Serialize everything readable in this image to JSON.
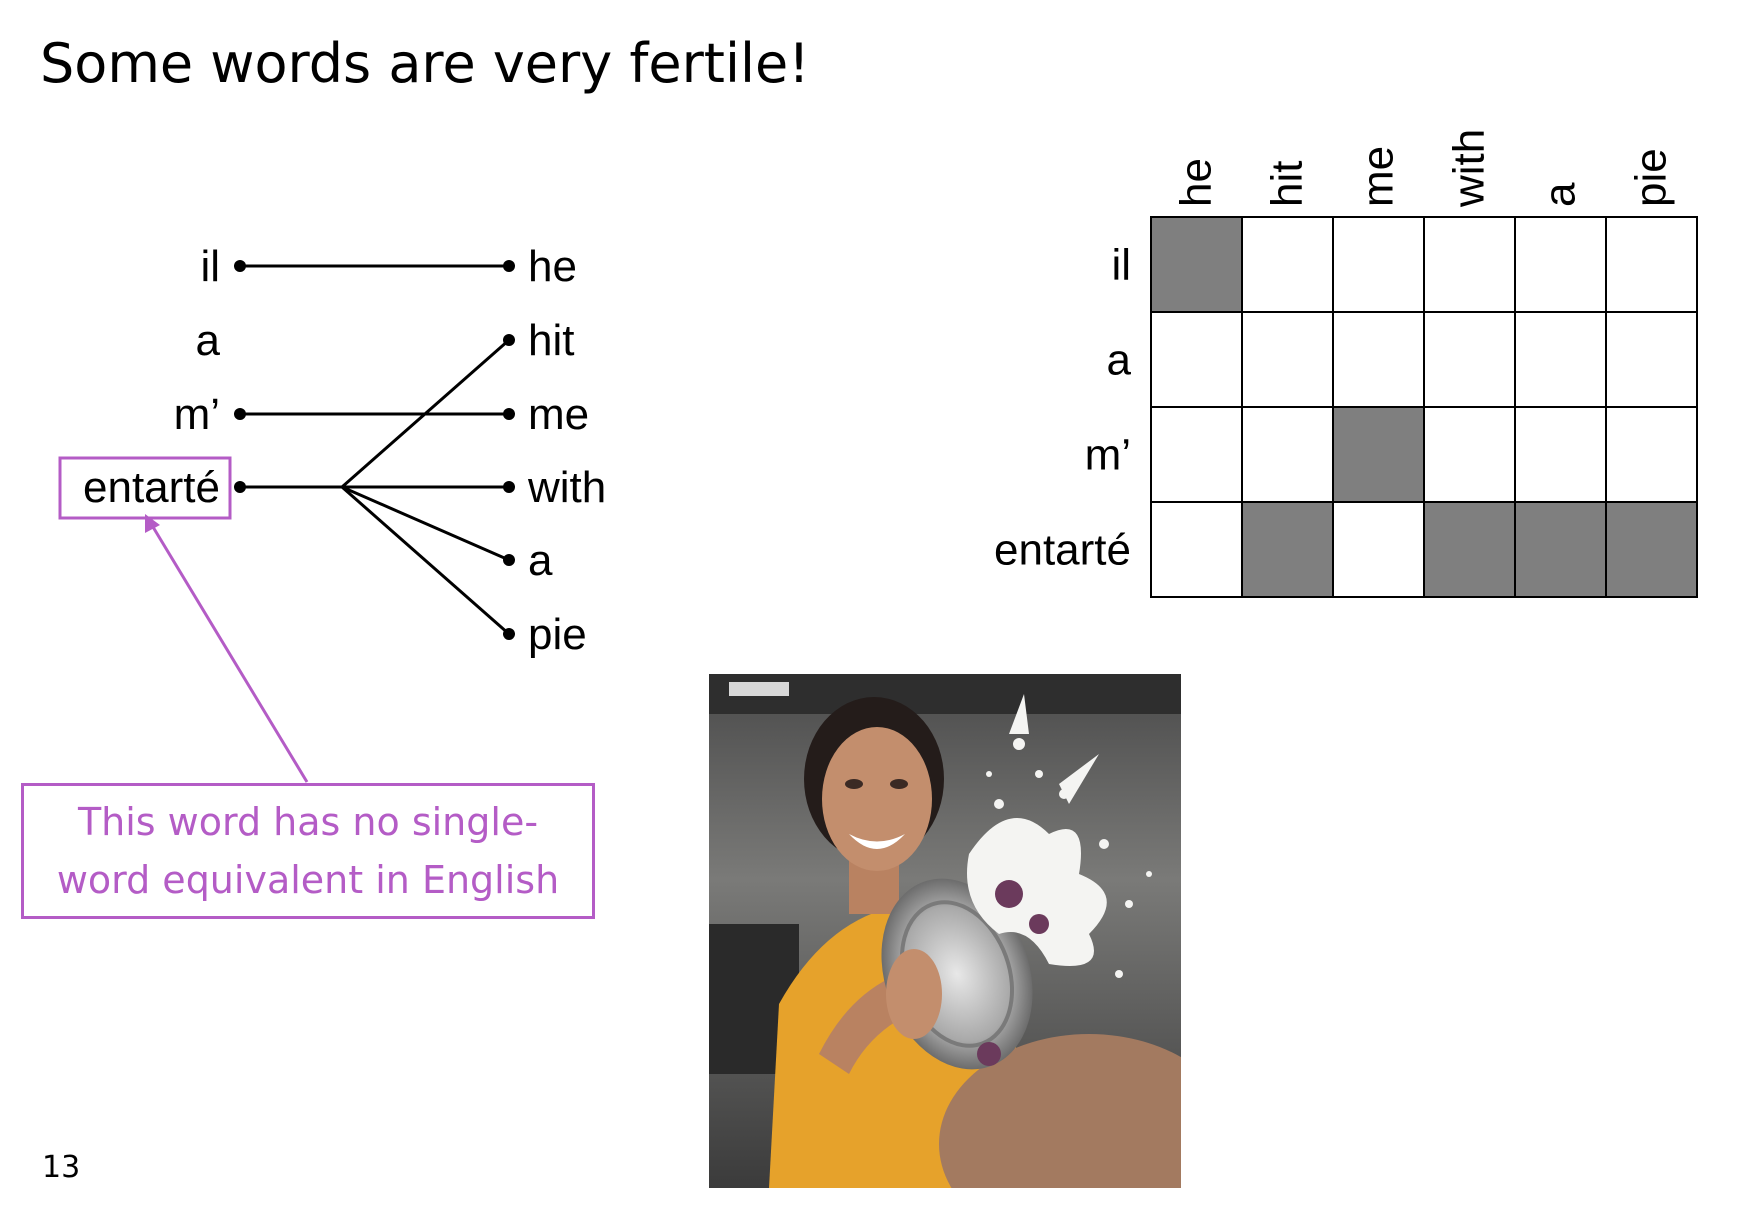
{
  "slide": {
    "title": "Some words are very fertile!",
    "page_number": "13"
  },
  "alignment_lines": {
    "french_words": [
      "il",
      "a",
      "m’",
      "entarté"
    ],
    "english_words": [
      "he",
      "hit",
      "me",
      "with",
      "a",
      "pie"
    ],
    "links": [
      {
        "fr": "il",
        "en": "he"
      },
      {
        "fr": "m’",
        "en": "me"
      },
      {
        "fr": "entarté",
        "en": "hit"
      },
      {
        "fr": "entarté",
        "en": "with"
      },
      {
        "fr": "entarté",
        "en": "a"
      },
      {
        "fr": "entarté",
        "en": "pie"
      }
    ],
    "highlighted_word": "entarté",
    "highlight_color": "#b45cc6"
  },
  "callout": {
    "text": "This word has no single-word equivalent in English",
    "color": "#b45cc6"
  },
  "alignment_matrix": {
    "rows": [
      "il",
      "a",
      "m’",
      "entarté"
    ],
    "columns": [
      "he",
      "hit",
      "me",
      "with",
      "a",
      "pie"
    ],
    "filled": [
      [
        1,
        0,
        0,
        0,
        0,
        0
      ],
      [
        0,
        0,
        0,
        0,
        0,
        0
      ],
      [
        0,
        0,
        1,
        0,
        0,
        0
      ],
      [
        0,
        1,
        0,
        1,
        1,
        1
      ]
    ],
    "fill_color": "#7f7f7f"
  },
  "photo": {
    "subject": "woman in yellow shirt hit in the face with a pie"
  }
}
